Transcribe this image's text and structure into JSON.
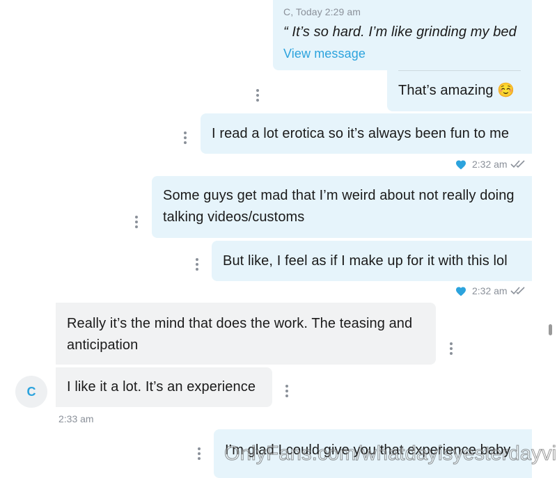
{
  "quoted": {
    "header": "C, Today 2:29 am",
    "text": "“ It’s so hard. I’m like grinding my bed",
    "link": "View message"
  },
  "messages": [
    {
      "text": "That’s amazing ☺️"
    },
    {
      "text": "I read a lot erotica so it’s always been fun to me"
    },
    {
      "text": "Some guys get mad that I’m weird about not really doing talking videos/customs"
    },
    {
      "text": "But like, I feel as if I make up for it with this lol"
    },
    {
      "text": "Really it’s the mind that does the work. The teasing and anticipation"
    },
    {
      "text": "I like it a lot. It’s an experience"
    },
    {
      "text": "I’m glad I could give you that experience baby"
    }
  ],
  "meta": {
    "time_1": "2:32 am",
    "time_2": "2:32 am",
    "time_3": "2:33 am"
  },
  "avatar_initial": "C",
  "watermark": "OnlyFans.com/whatdayisyesterdayvip",
  "colors": {
    "accent": "#2ca3dd",
    "outgoing_bubble": "#e6f4fb",
    "incoming_bubble": "#f1f2f3"
  }
}
